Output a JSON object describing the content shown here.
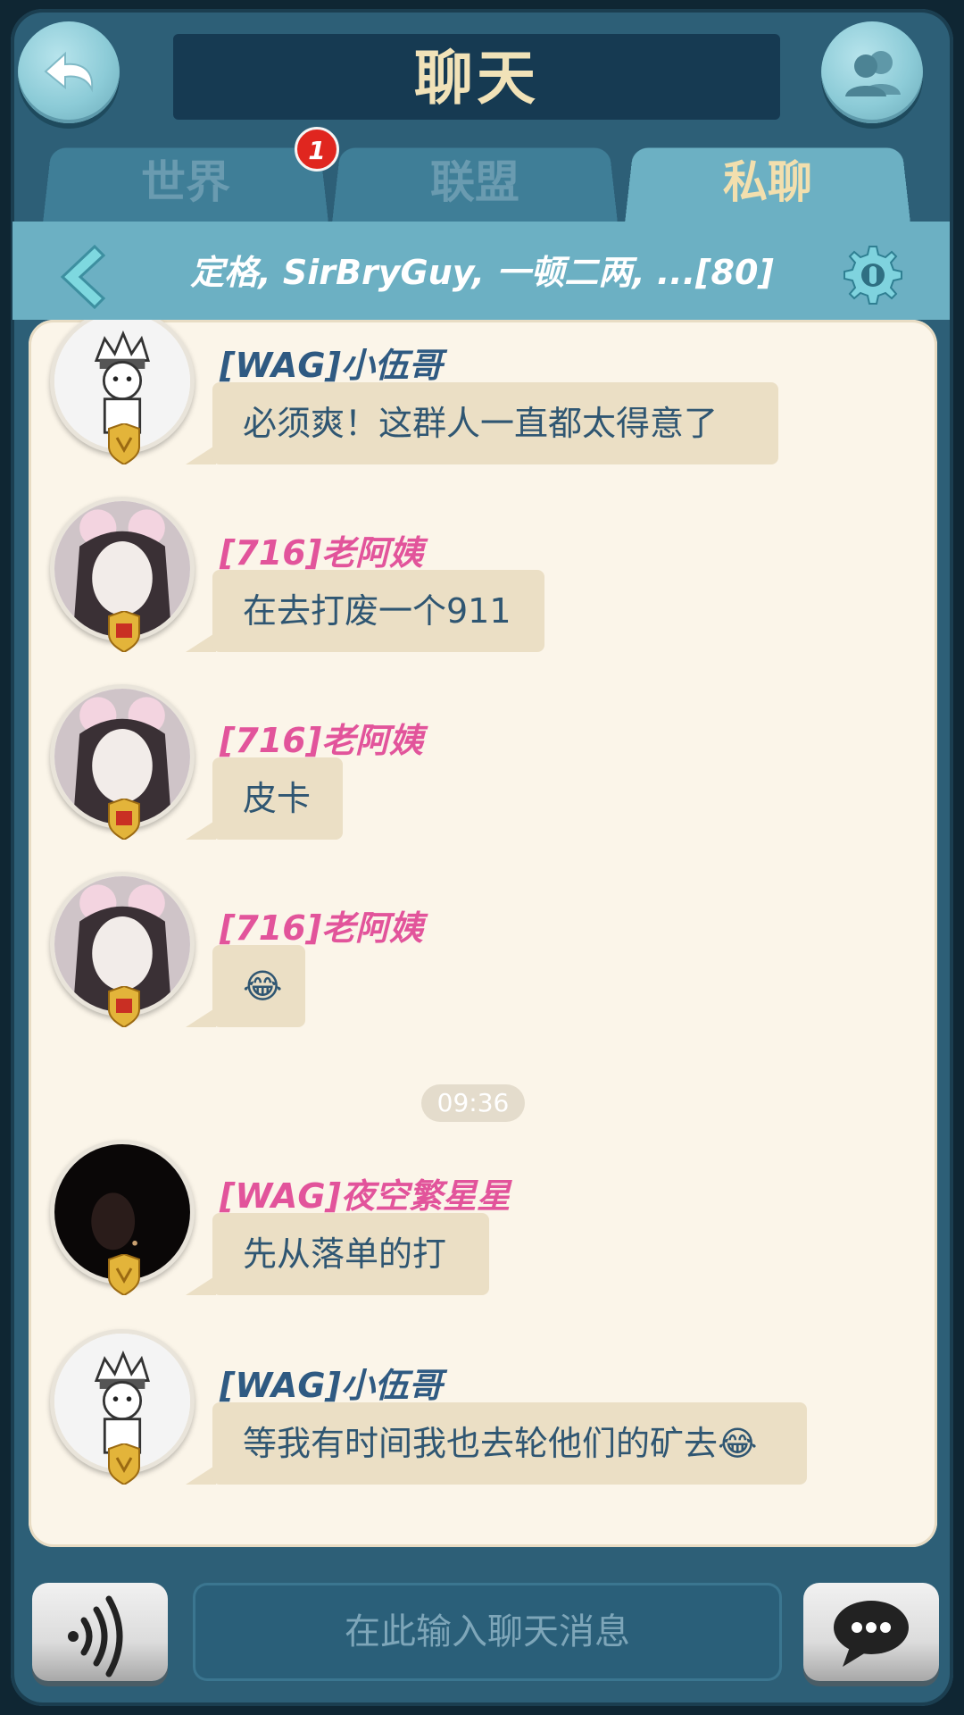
{
  "header": {
    "title": "聊天"
  },
  "tabs": [
    {
      "label": "世界",
      "badge": "1"
    },
    {
      "label": "联盟"
    },
    {
      "label": "私聊",
      "active": true
    }
  ],
  "conversation": {
    "participants": "定格, SirBryGuy, 一顿二两, ...[80]"
  },
  "messages": [
    {
      "sender": "[WAG]小伍哥",
      "sender_color": "#2f5a82",
      "text": "必须爽！这群人一直都太得意了",
      "avatar": "cartoon-avatar"
    },
    {
      "sender": "[716]老阿姨",
      "sender_color": "#e2549b",
      "text": "在去打废一个911",
      "avatar": "photo-avatar"
    },
    {
      "sender": "[716]老阿姨",
      "sender_color": "#e2549b",
      "text": "皮卡",
      "avatar": "photo-avatar"
    },
    {
      "sender": "[716]老阿姨",
      "sender_color": "#e2549b",
      "text": "😂",
      "avatar": "photo-avatar"
    },
    {
      "sender": "[WAG]夜空繁星星",
      "sender_color": "#e2549b",
      "text": "先从落单的打",
      "avatar": "dark-photo-avatar"
    },
    {
      "sender": "[WAG]小伍哥",
      "sender_color": "#2f5a82",
      "text": "等我有时间我也去轮他们的矿去😂",
      "avatar": "cartoon-avatar"
    }
  ],
  "timestamp": "09:36",
  "composer": {
    "placeholder": "在此输入聊天消息"
  },
  "colors": {
    "frame": "#2d5f77",
    "tab_active": "#6cb0c3",
    "panel": "#fbf5e9",
    "bubble": "#ebdfc5"
  }
}
